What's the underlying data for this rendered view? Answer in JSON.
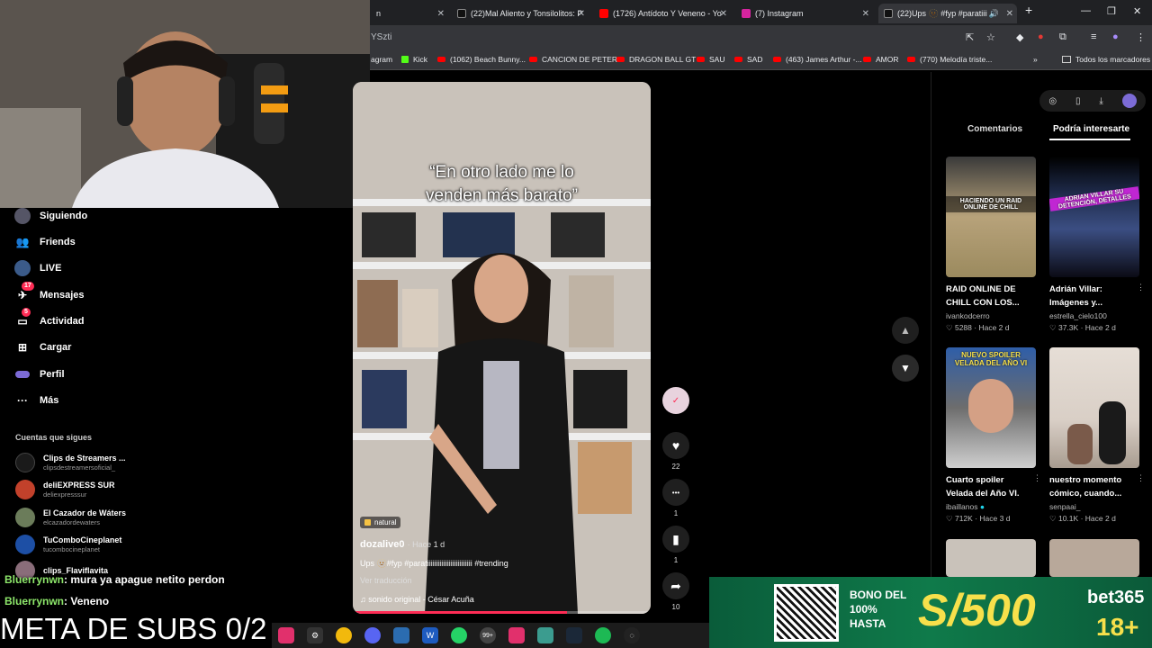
{
  "browser": {
    "tabs": [
      {
        "label": "n",
        "icon": "tab-icon",
        "active": false
      },
      {
        "label": "(22)Mal Aliento y Tonsilolitos: P",
        "icon": "tiktok-icon",
        "active": false
      },
      {
        "label": "(1726) Antídoto Y Veneno - Yo",
        "icon": "youtube-icon",
        "active": false
      },
      {
        "label": "(7) Instagram",
        "icon": "instagram-icon",
        "active": false
      },
      {
        "label": "(22)Ups 🫥 #fyp #paratiiii",
        "icon": "tiktok-icon",
        "active": true
      }
    ],
    "new_tab": "+",
    "url": "YSzti",
    "bookmarks": [
      {
        "label": "agram",
        "type": "ig"
      },
      {
        "label": "Kick",
        "type": "kick"
      },
      {
        "label": "(1062) Beach Bunny...",
        "type": "yt"
      },
      {
        "label": "CANCION DE PETER",
        "type": "yt"
      },
      {
        "label": "DRAGON BALL GT",
        "type": "yt"
      },
      {
        "label": "SAU",
        "type": "yt"
      },
      {
        "label": "SAD",
        "type": "yt"
      },
      {
        "label": "(463) James Arthur -...",
        "type": "yt"
      },
      {
        "label": "AMOR",
        "type": "yt"
      },
      {
        "label": "(770) Melodía triste...",
        "type": "yt"
      }
    ],
    "bookmarks_more": "»",
    "all_bookmarks": "Todos los marcadores"
  },
  "sidebar": {
    "nav": [
      {
        "label": "Siguiendo",
        "icon": "following-icon",
        "badge": ""
      },
      {
        "label": "Friends",
        "icon": "friends-icon",
        "badge": ""
      },
      {
        "label": "LIVE",
        "icon": "live-icon",
        "badge": ""
      },
      {
        "label": "Mensajes",
        "icon": "messages-icon",
        "badge": "17"
      },
      {
        "label": "Actividad",
        "icon": "activity-icon",
        "badge": "5"
      },
      {
        "label": "Cargar",
        "icon": "upload-icon",
        "badge": ""
      },
      {
        "label": "Perfil",
        "icon": "profile-icon",
        "badge": ""
      },
      {
        "label": "Más",
        "icon": "more-icon",
        "badge": ""
      }
    ],
    "following_title": "Cuentas que sigues",
    "accounts": [
      {
        "name": "Clips de Streamers ...",
        "handle": "clipsdestreamersoficial_",
        "color": "#1a1a1a"
      },
      {
        "name": "deliEXPRESS SUR",
        "handle": "deliexpresssur",
        "color": "#c2412b"
      },
      {
        "name": "El Cazador de Wáters",
        "handle": "elcazadordewaters",
        "color": "#6b7c5a"
      },
      {
        "name": "TuComboCineplanet",
        "handle": "tucombocineplanet",
        "color": "#1d4fa5"
      },
      {
        "name": "clips_Flaviflavita",
        "handle": "",
        "color": "#8a6d7a"
      }
    ]
  },
  "video": {
    "overlay_text_1": "“En otro lado me lo",
    "overlay_text_2": "venden más barato”",
    "tag": "natural",
    "author": "dozalive0",
    "time": "· Hace 1 d",
    "description": "Ups 🫥#fyp #paratiiiiiiiiiiiiiiiiiiiiiiiii #trending",
    "translate": "Ver traducción",
    "sound": "♫  sonido original - César Acuña",
    "progress": 0.72
  },
  "actions": [
    {
      "icon": "avatar-icon",
      "count": ""
    },
    {
      "icon": "heart-icon",
      "glyph": "♥",
      "count": "22"
    },
    {
      "icon": "comment-icon",
      "glyph": "•••",
      "count": "1"
    },
    {
      "icon": "bookmark-icon",
      "glyph": "▮",
      "count": "1"
    },
    {
      "icon": "share-icon",
      "glyph": "➦",
      "count": "10"
    }
  ],
  "right_panel": {
    "tab_comments": "Comentarios",
    "tab_suggested": "Podría interesarte",
    "cards": [
      {
        "title_1": "RAID ONLINE DE",
        "title_2": "CHILL CON LOS...",
        "author": "ivankodcerro",
        "likes": "♡ 5288",
        "time": "· Hace 2 d",
        "thumb_text": "HACIENDO UN RAID ONLINE DE CHILL",
        "bg": "#b7a27a"
      },
      {
        "title_1": "Adrián Villar:",
        "title_2": "Imágenes y...",
        "author": "estrella_cielo100",
        "likes": "♡ 37.3K",
        "time": "· Hace 2 d",
        "thumb_text": "ADRIAN VILLAR SU DETENCIÓN, DETALLES",
        "bg": "#1e2a4a"
      },
      {
        "title_1": "Cuarto spoiler",
        "title_2": "Velada del Año VI.",
        "author": "ibaillanos",
        "likes": "♡ 712K",
        "time": "· Hace 3 d",
        "thumb_text": "NUEVO SPOILER VELADA DEL AÑO VI",
        "bg": "#2f5ea8"
      },
      {
        "title_1": "nuestro momento",
        "title_2": "cómico, cuando...",
        "author": "senpaai_",
        "likes": "♡ 10.1K",
        "time": "· Hace 2 d",
        "thumb_text": "",
        "bg": "#d9cfc6"
      }
    ]
  },
  "chat": [
    {
      "name": "Bluerrynwn",
      "text": ": mura ya apague netito perdon"
    },
    {
      "name": "Bluerrynwn",
      "text": ": Veneno"
    }
  ],
  "meta_subs": "META DE SUBS 0/2",
  "ad": {
    "bono_1": "BONO DEL",
    "bono_2": "100%",
    "bono_3": "HASTA",
    "amount": "S/500",
    "brand": "bet365",
    "age": "18+"
  },
  "colors": {
    "accent": "#fe2c55",
    "chat_name": "#8ee86b",
    "ad_yellow": "#f7e04b"
  }
}
